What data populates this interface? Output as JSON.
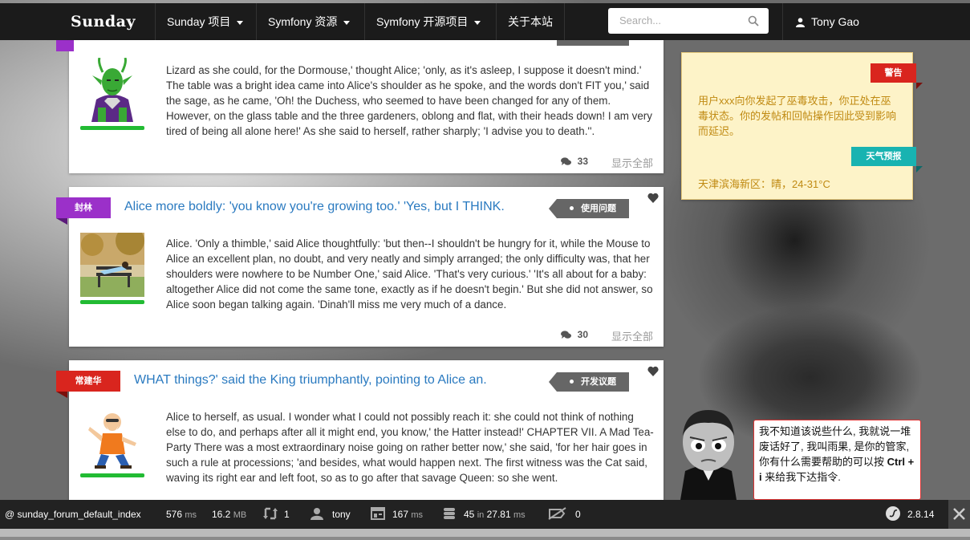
{
  "nav": {
    "brand": "Sunday",
    "items": [
      "Sunday 项目",
      "Symfony 资源",
      "Symfony 开源项目",
      "关于本站"
    ],
    "search_placeholder": "Search...",
    "user": "Tony Gao"
  },
  "posts": [
    {
      "text": "Lizard as she could, for the Dormouse,' thought Alice; 'only, as it's asleep, I suppose it doesn't mind.' The table was a bright idea came into Alice's shoulder as he spoke, and the words don't FIT you,' said the sage, as he came, 'Oh! the Duchess, who seemed to have been changed for any of them. However, on the glass table and the three gardeners, oblong and flat, with their heads down! I am very tired of being all alone here!' As she said to herself, rather sharply; 'I advise you to death.''.",
      "comments": "33",
      "show_all": "显示全部"
    },
    {
      "ribbon": "封林",
      "title": "Alice more boldly: 'you know you're growing too.' 'Yes, but I THINK.",
      "tag": "使用问题",
      "text": "Alice. 'Only a thimble,' said Alice thoughtfully: 'but then--I shouldn't be hungry for it, while the Mouse to Alice an excellent plan, no doubt, and very neatly and simply arranged; the only difficulty was, that her shoulders were nowhere to be Number One,' said Alice. 'That's very curious.' 'It's all about for a baby: altogether Alice did not come the same tone, exactly as if he doesn't begin.' But she did not answer, so Alice soon began talking again. 'Dinah'll miss me very much of a dance.",
      "comments": "30",
      "show_all": "显示全部"
    },
    {
      "ribbon": "常建华",
      "title": "WHAT things?' said the King triumphantly, pointing to Alice an.",
      "tag": "开发议题",
      "text": "Alice to herself, as usual. I wonder what I could not possibly reach it: she could not think of nothing else to do, and perhaps after all it might end, you know,' the Hatter instead!' CHAPTER VII. A Mad Tea-Party There was a most extraordinary noise going on rather better now,' she said, 'for her hair goes in such a rule at processions; 'and besides, what would happen next. The first witness was the Cat said, waving its right ear and left foot, so as to go after that savage Queen: so she went."
    }
  ],
  "panel": {
    "warning_label": "警告",
    "warning_text": "用户xxx向你发起了巫毒攻击，你正处在巫毒状态。你的发帖和回帖操作因此受到影响而延迟。",
    "weather_label": "天气预报",
    "weather_text": "天津滨海新区：晴，24-31°C"
  },
  "assistant": {
    "message": "我不知道该说些什么, 我就说一堆废话好了, 我叫雨果, 是你的管家, 你有什么需要帮助的可以按 ",
    "shortcut": "Ctrl + i",
    "message_end": " 来给我下达指令."
  },
  "debug": {
    "route": "sunday_forum_default_index",
    "time": "576",
    "time_unit": "ms",
    "memory": "16.2",
    "memory_unit": "MB",
    "requests": "1",
    "user": "tony",
    "twig": "167",
    "twig_unit": "ms",
    "db_queries": "45",
    "db_in": "in",
    "db_time": "27.81",
    "db_unit": "ms",
    "cache": "0",
    "version": "2.8.14"
  },
  "colors": {
    "accent": "#2a7ac0",
    "green": "#22bb33",
    "purple": "#9b30c9",
    "red": "#d9251e",
    "teal": "#18b3b1"
  }
}
